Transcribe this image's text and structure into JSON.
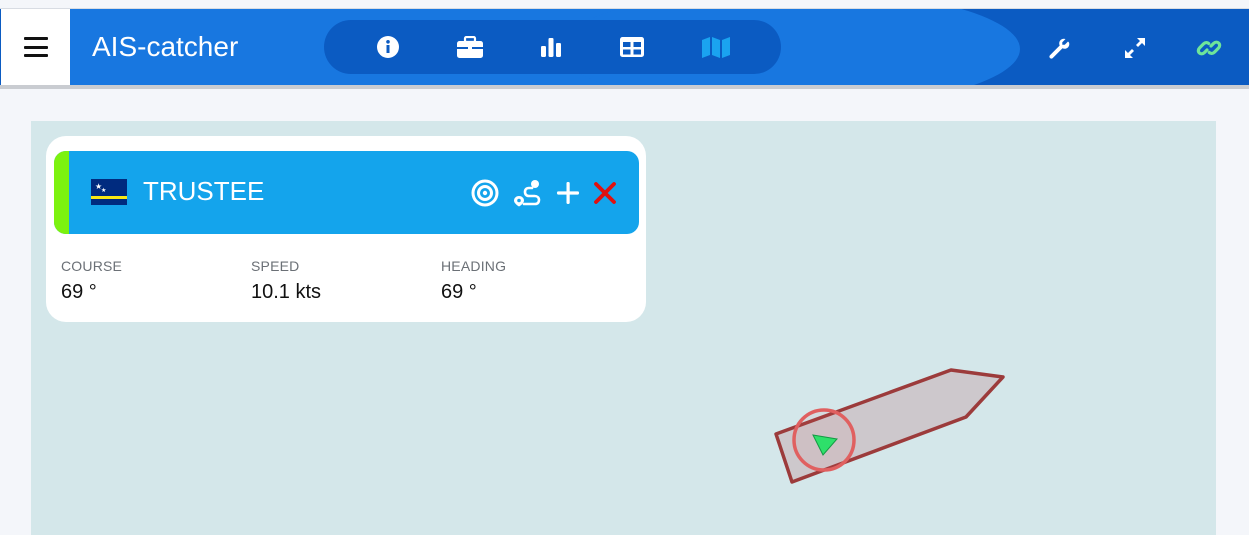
{
  "header": {
    "app_title": "AIS-catcher",
    "nav_icons": [
      "info-icon",
      "briefcase-icon",
      "chart-icon",
      "table-icon",
      "map-icon"
    ],
    "right_icons": [
      "wrench-icon",
      "expand-icon",
      "link-icon"
    ],
    "colors": {
      "bar": "#0b5bc2",
      "bar_light": "#1877e0",
      "active_icon": "#1aa3f0",
      "link_icon": "#6ee59a"
    }
  },
  "vessel": {
    "name": "TRUSTEE",
    "flag": "curacao-flag-icon",
    "actions": [
      "target-icon",
      "route-icon",
      "plus-icon",
      "close-icon"
    ],
    "colors": {
      "header": "#14a4ec",
      "status_stripe": "#7cf20f",
      "close": "#e01010"
    },
    "stats": [
      {
        "label": "COURSE",
        "value": "69 °"
      },
      {
        "label": "SPEED",
        "value": "10.1 kts"
      },
      {
        "label": "HEADING",
        "value": "69 °"
      }
    ]
  },
  "map": {
    "background": "#d4e7ea",
    "ship_outline_color": "#9c3b3b",
    "marker_color": "#2ee06a",
    "selection_ring_color": "#e06060"
  }
}
